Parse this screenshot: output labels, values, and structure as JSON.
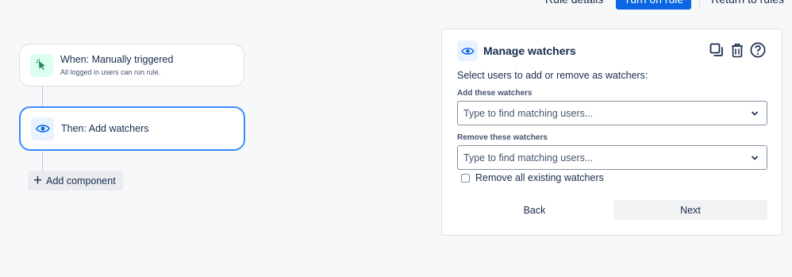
{
  "toolbar": {
    "rule_details": "Rule details",
    "turn_on_rule": "Turn on rule",
    "return_to_rules": "Return to rules"
  },
  "flow": {
    "trigger": {
      "title": "When: Manually triggered",
      "subtitle": "All logged in users can run rule.",
      "icon": "cursor-click-icon"
    },
    "action": {
      "title": "Then: Add watchers",
      "icon": "eye-icon"
    },
    "add_component": "Add component"
  },
  "panel": {
    "title": "Manage watchers",
    "icon": "eye-icon",
    "header_icons": [
      "copy-icon",
      "trash-icon",
      "help-icon"
    ],
    "instruction": "Select users to add or remove as watchers:",
    "add_label": "Add these watchers",
    "add_placeholder": "Type to find matching users...",
    "remove_label": "Remove these watchers",
    "remove_placeholder": "Type to find matching users...",
    "remove_all_label": "Remove all existing watchers",
    "remove_all_checked": false,
    "back_label": "Back",
    "next_label": "Next"
  },
  "colors": {
    "primary": "#0c66e4",
    "selected_border": "#388bff",
    "trigger_icon_bg": "#dcfff1",
    "trigger_icon": "#1f845a",
    "action_icon_bg": "#e9f2ff",
    "action_icon": "#0c66e4"
  }
}
